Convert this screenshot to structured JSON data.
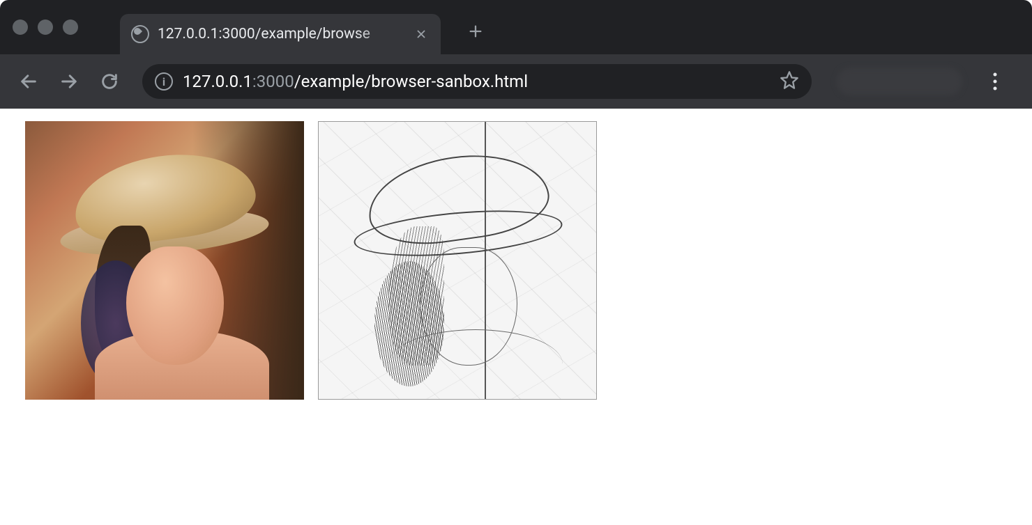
{
  "browser": {
    "tab_title": "127.0.0.1:3000/example/browse",
    "url_host": "127.0.0.1",
    "url_port": ":3000",
    "url_path": "/example/browser-sanbox.html"
  },
  "icons": {
    "globe": "globe-icon",
    "close": "close-icon",
    "plus": "plus-icon",
    "back": "back-arrow-icon",
    "forward": "forward-arrow-icon",
    "reload": "reload-icon",
    "info": "info-icon",
    "star": "star-icon",
    "menu": "kebab-menu-icon"
  },
  "content": {
    "image_left_label": "original-color-image",
    "image_right_label": "edge-detected-sketch-image"
  }
}
